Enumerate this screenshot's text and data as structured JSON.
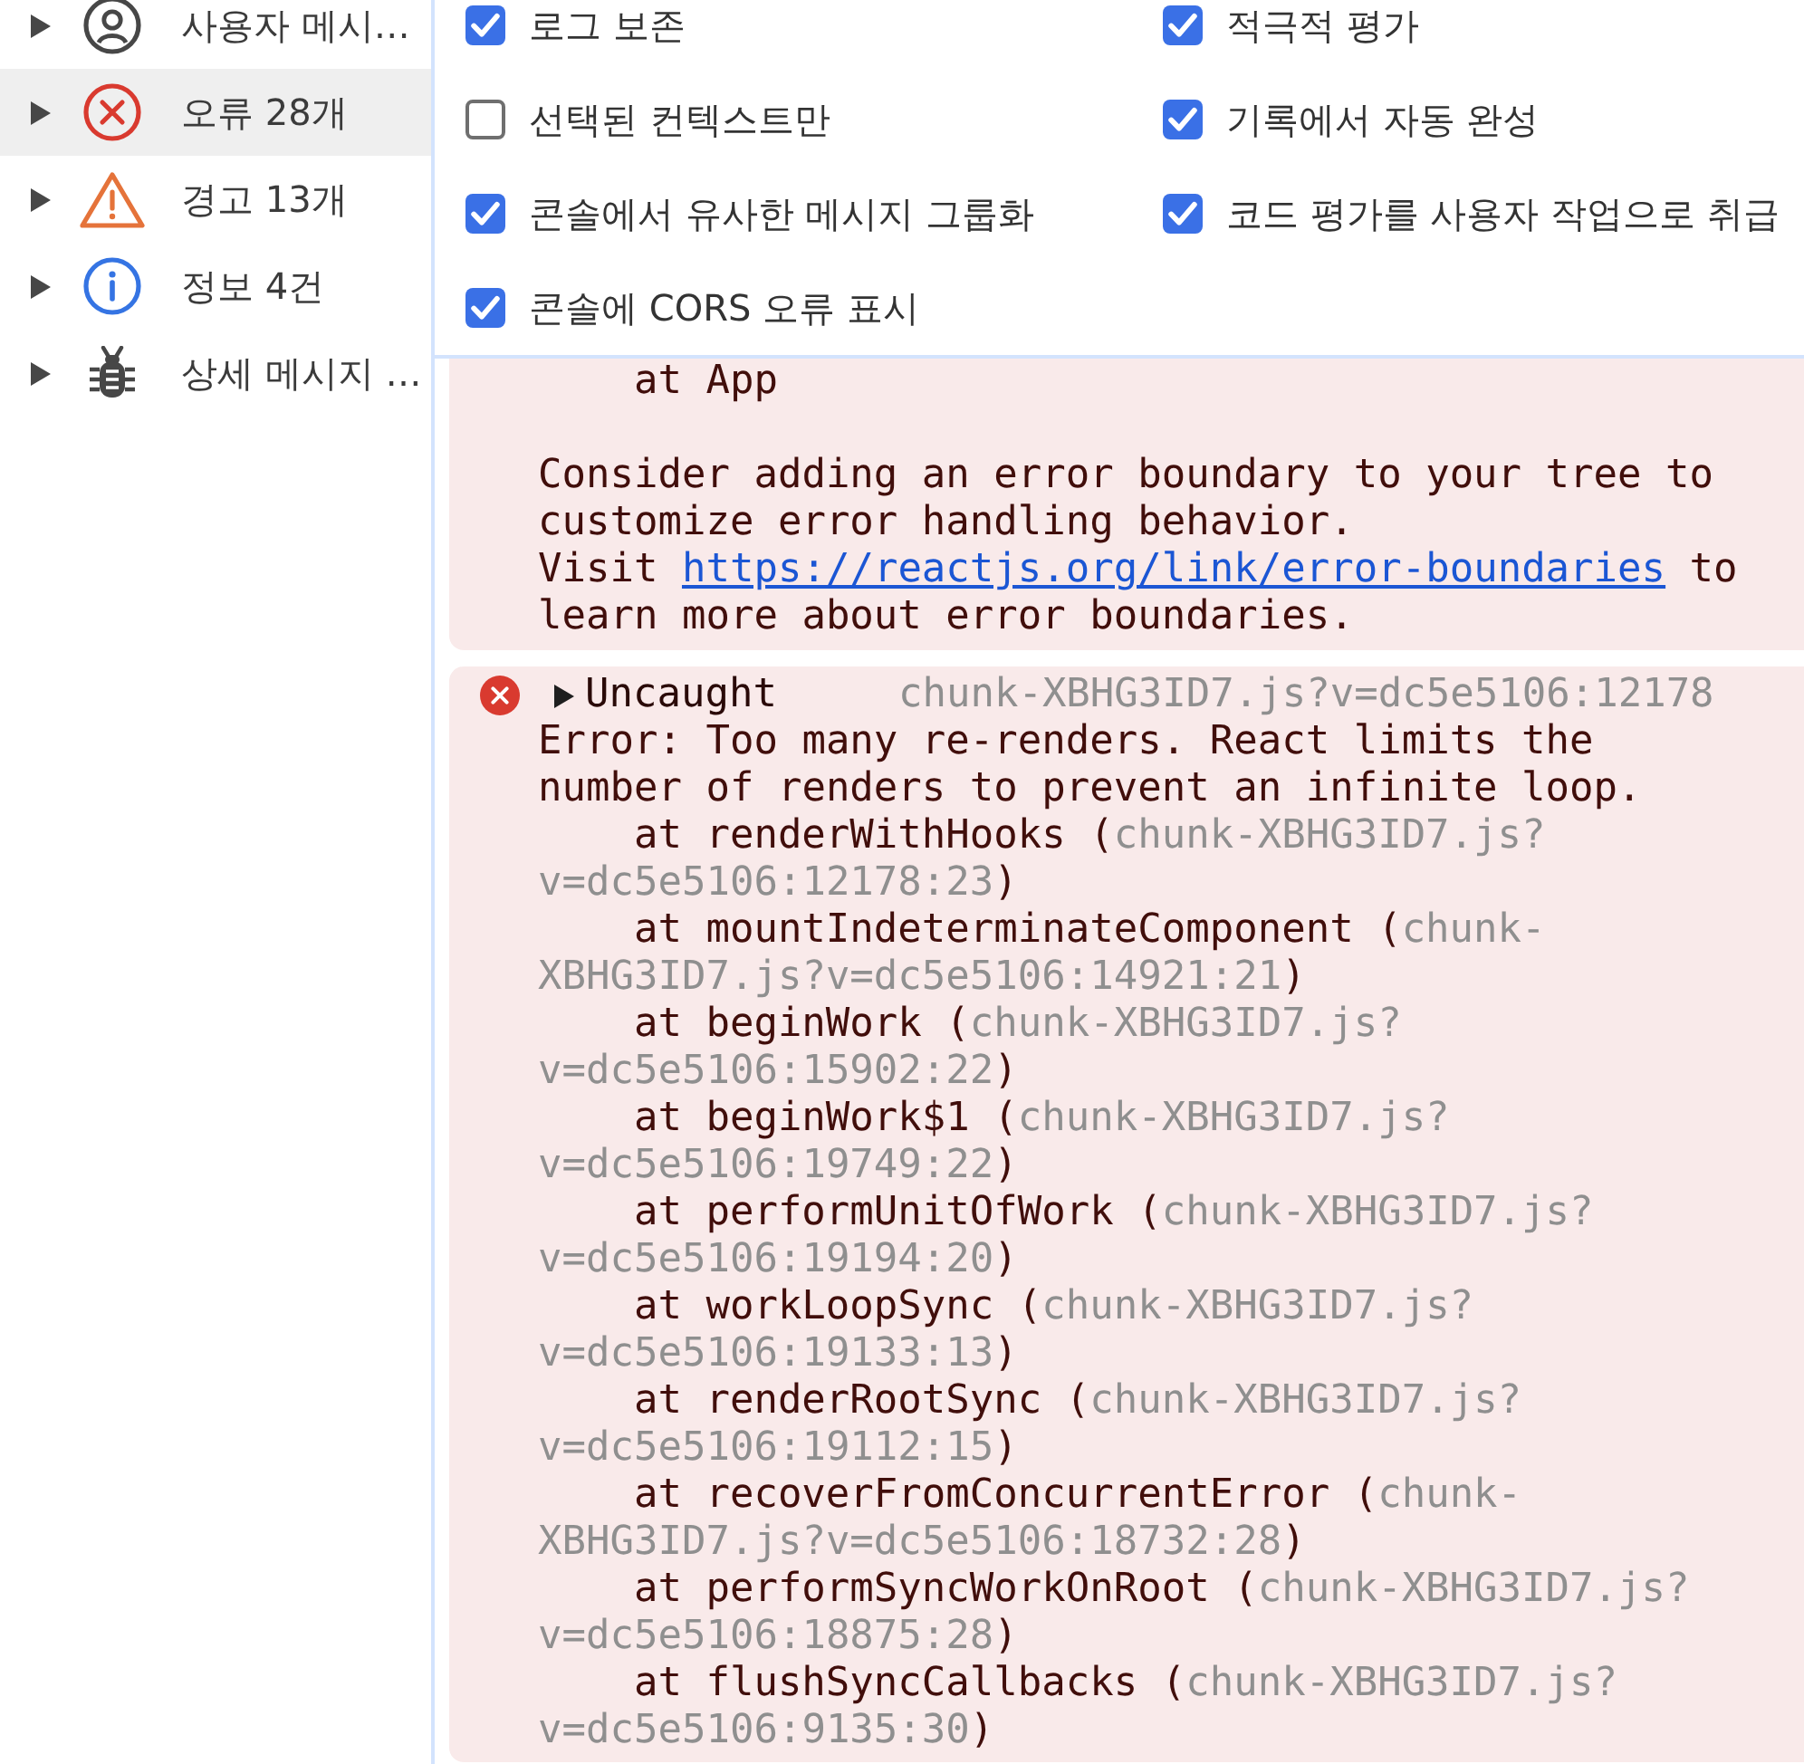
{
  "sidebar": {
    "items": [
      {
        "kind": "user",
        "label": "사용자 메시…",
        "selected": false,
        "expanded": false
      },
      {
        "kind": "error",
        "label": "오류 28개",
        "selected": true,
        "expanded": false
      },
      {
        "kind": "warning",
        "label": "경고 13개",
        "selected": false,
        "expanded": false
      },
      {
        "kind": "info",
        "label": "정보 4건",
        "selected": false,
        "expanded": false
      },
      {
        "kind": "verbose",
        "label": "상세 메시지 …",
        "selected": false,
        "expanded": false
      }
    ]
  },
  "settings": {
    "options": [
      {
        "label": "로그 보존",
        "checked": true
      },
      {
        "label": "적극적 평가",
        "checked": true
      },
      {
        "label": "선택된 컨텍스트만",
        "checked": false
      },
      {
        "label": "기록에서 자동 완성",
        "checked": true
      },
      {
        "label": "콘솔에서 유사한 메시지 그룹화",
        "checked": true
      },
      {
        "label": "코드 평가를 사용자 작업으로 취급",
        "checked": true
      },
      {
        "label": "콘솔에 CORS 오류 표시",
        "checked": true
      }
    ]
  },
  "console": {
    "messages": [
      {
        "kind": "error",
        "stack": [
          {
            "call": "at App"
          }
        ],
        "paragraphs": [
          {
            "text": "Consider adding an error boundary to your tree to customize error handling behavior."
          },
          {
            "text": "Visit ",
            "link": "https://reactjs.org/link/error-boundaries",
            "after": " to learn more about error boundaries."
          }
        ]
      },
      {
        "kind": "error",
        "expanded": false,
        "title": "Uncaught",
        "source": "chunk-XBHG3ID7.js?v=dc5e5106:12178",
        "text": "Error: Too many re-renders. React limits the number of renders to prevent an infinite loop.",
        "stack": [
          {
            "call": "at renderWithHooks (",
            "source": [
              "chunk-XBHG3ID7.js?",
              "v=dc5e5106:12178:23"
            ],
            "close": ")"
          },
          {
            "call": "at mountIndeterminateComponent (",
            "source": [
              "chunk-",
              "XBHG3ID7.js?v=dc5e5106:14921:21"
            ],
            "close": ")"
          },
          {
            "call": "at beginWork (",
            "source": [
              "chunk-XBHG3ID7.js?",
              "v=dc5e5106:15902:22"
            ],
            "close": ")"
          },
          {
            "call": "at beginWork$1 (",
            "source": [
              "chunk-XBHG3ID7.js?",
              "v=dc5e5106:19749:22"
            ],
            "close": ")"
          },
          {
            "call": "at performUnitOfWork (",
            "source": [
              "chunk-XBHG3ID7.js?",
              "v=dc5e5106:19194:20"
            ],
            "close": ")"
          },
          {
            "call": "at workLoopSync (",
            "source": [
              "chunk-XBHG3ID7.js?",
              "v=dc5e5106:19133:13"
            ],
            "close": ")"
          },
          {
            "call": "at renderRootSync (",
            "source": [
              "chunk-XBHG3ID7.js?",
              "v=dc5e5106:19112:15"
            ],
            "close": ")"
          },
          {
            "call": "at recoverFromConcurrentError (",
            "source": [
              "chunk-",
              "XBHG3ID7.js?v=dc5e5106:18732:28"
            ],
            "close": ")"
          },
          {
            "call": "at performSyncWorkOnRoot (",
            "source": [
              "chunk-XBHG3ID7.js?",
              "v=dc5e5106:18875:28"
            ],
            "close": ")"
          },
          {
            "call": "at flushSyncCallbacks (",
            "source": [
              "chunk-XBHG3ID7.js?",
              "v=dc5e5106:9135:30"
            ],
            "close": ")"
          }
        ]
      }
    ]
  }
}
